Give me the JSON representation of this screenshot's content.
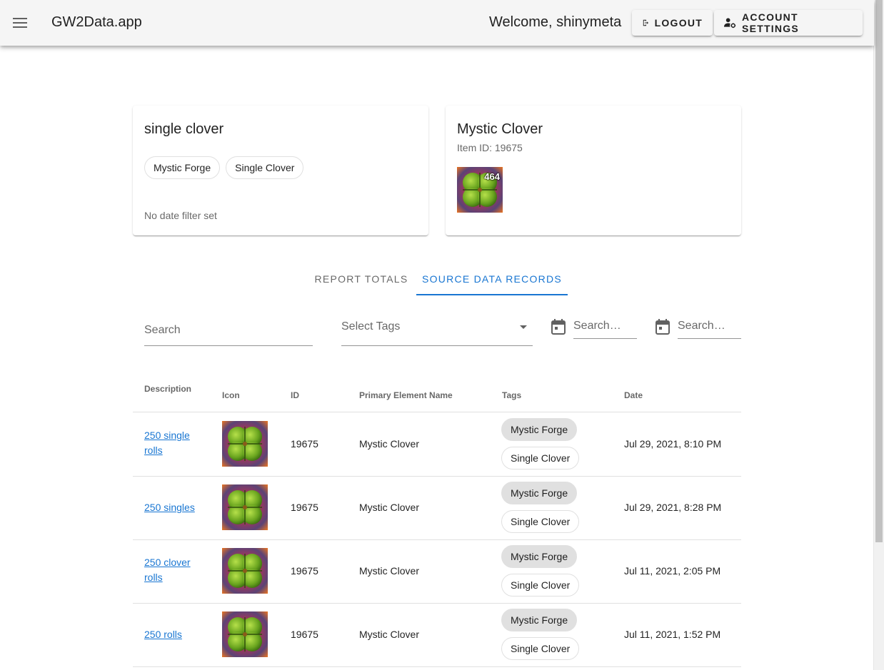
{
  "appbar": {
    "title": "GW2Data.app",
    "welcome": "Welcome, shinymeta",
    "logout_label": "Logout",
    "settings_label": "Account Settings"
  },
  "report_card": {
    "title": "single clover",
    "tags": [
      "Mystic Forge",
      "Single Clover"
    ],
    "note": "No date filter set"
  },
  "item_card": {
    "title": "Mystic Clover",
    "subtitle": "Item ID: 19675",
    "quantity": "464"
  },
  "tabs": {
    "totals": "Report Totals",
    "source": "Source Data Records",
    "active": "source"
  },
  "filters": {
    "search_placeholder": "Search",
    "tags_label": "Select Tags",
    "date_from_placeholder": "Search…",
    "date_to_placeholder": "Search…"
  },
  "table": {
    "headers": {
      "description": "Description",
      "icon": "Icon",
      "id": "ID",
      "name": "Primary Element Name",
      "tags": "Tags",
      "date": "Date"
    },
    "rows": [
      {
        "description": "250 single rolls",
        "id": "19675",
        "name": "Mystic Clover",
        "tags": [
          "Mystic Forge",
          "Single Clover"
        ],
        "date": "Jul 29, 2021, 8:10 PM"
      },
      {
        "description": "250 singles",
        "id": "19675",
        "name": "Mystic Clover",
        "tags": [
          "Mystic Forge",
          "Single Clover"
        ],
        "date": "Jul 29, 2021, 8:28 PM"
      },
      {
        "description": "250 clover rolls",
        "id": "19675",
        "name": "Mystic Clover",
        "tags": [
          "Mystic Forge",
          "Single Clover"
        ],
        "date": "Jul 11, 2021, 2:05 PM"
      },
      {
        "description": "250 rolls",
        "id": "19675",
        "name": "Mystic Clover",
        "tags": [
          "Mystic Forge",
          "Single Clover"
        ],
        "date": "Jul 11, 2021, 1:52 PM"
      }
    ]
  },
  "colors": {
    "accent": "#1976d2",
    "appbar_bg": "#f5f5f5"
  }
}
